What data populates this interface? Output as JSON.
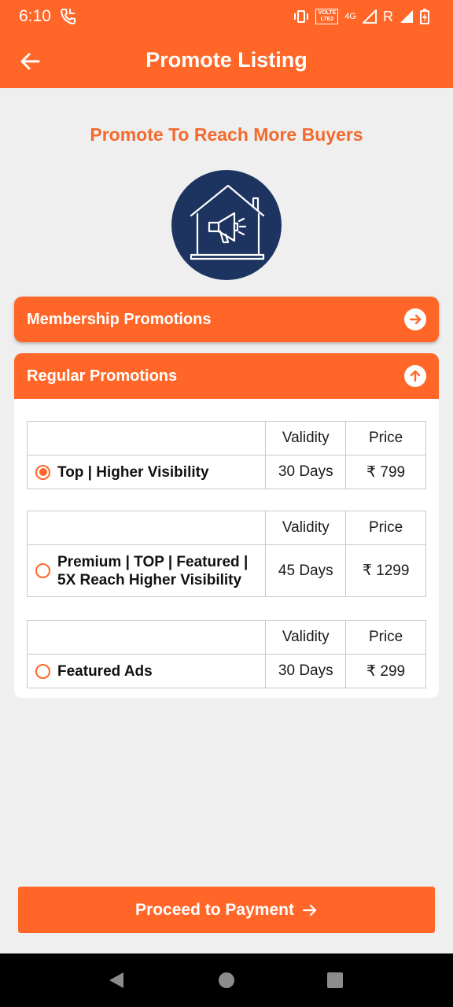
{
  "status_bar": {
    "time": "6:10",
    "volte_label": "VOLTE",
    "lte_sub": "LTE2",
    "network": "4G",
    "roaming": "R",
    "icons": [
      "call-icon",
      "vibrate-icon",
      "signal-icon",
      "battery-icon"
    ]
  },
  "app_bar": {
    "title": "Promote Listing",
    "back_icon": "arrow-left-icon"
  },
  "headline": "Promote To Reach More Buyers",
  "hero_icon": "house-megaphone-icon",
  "sections": {
    "membership": {
      "label": "Membership Promotions",
      "icon": "arrow-right-circle-icon"
    },
    "regular": {
      "label": "Regular Promotions",
      "icon": "arrow-up-circle-icon"
    }
  },
  "plans": {
    "headers": {
      "validity": "Validity",
      "price": "Price"
    },
    "items": [
      {
        "name_line1": "Top | Higher Visibility",
        "name_line2": "",
        "validity": "30 Days",
        "price": "₹ 799",
        "selected": true
      },
      {
        "name_line1": "Premium | TOP | Featured |",
        "name_line2": "5X Reach Higher Visibility",
        "validity": "45 Days",
        "price": "₹ 1299",
        "selected": false
      },
      {
        "name_line1": "Featured Ads",
        "name_line2": "",
        "validity": "30 Days",
        "price": "₹ 299",
        "selected": false
      }
    ]
  },
  "proceed_button": {
    "label": "Proceed to Payment",
    "icon": "arrow-right-icon"
  },
  "colors": {
    "accent": "#ff6628",
    "headline": "#f26a2e",
    "hero_bg": "#1d3461",
    "page_bg": "#efefef"
  },
  "nav_bar": {
    "icons": [
      "nav-back-icon",
      "nav-home-icon",
      "nav-recents-icon"
    ]
  }
}
